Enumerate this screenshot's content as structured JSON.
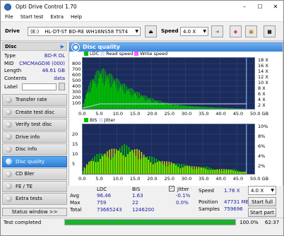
{
  "app": {
    "title": "Opti Drive Control 1.70"
  },
  "menu": [
    "File",
    "Start test",
    "Extra",
    "Help"
  ],
  "drivebar": {
    "drive_label": "Drive",
    "drive_letter": "(E:)",
    "drive_name": "HL-DT-ST BD-RE  WH16NS58 TST4",
    "speed_label": "Speed",
    "speed_value": "4.0 X"
  },
  "disc": {
    "heading": "Disc",
    "fields": [
      {
        "key": "Type",
        "value": "BD-R DL"
      },
      {
        "key": "MID",
        "value": "CMCMAGDI6 (000)"
      },
      {
        "key": "Length",
        "value": "46.61 GB"
      },
      {
        "key": "Contents",
        "value": "data"
      }
    ],
    "label_key": "Label"
  },
  "nav": [
    {
      "label": "Transfer rate"
    },
    {
      "label": "Create test disc"
    },
    {
      "label": "Verify test disc"
    },
    {
      "label": "Drive info"
    },
    {
      "label": "Disc info"
    },
    {
      "label": "Disc quality"
    },
    {
      "label": "CD Bler"
    },
    {
      "label": "FE / TE"
    },
    {
      "label": "Extra tests"
    }
  ],
  "status_window": "Status window >>",
  "panel": {
    "title": "Disc quality"
  },
  "chart_data": [
    {
      "type": "area",
      "legend": [
        "LDC",
        "Read speed",
        "Write speed"
      ],
      "x_ticks": [
        "0.0",
        "5.0",
        "10.0",
        "15.0",
        "20.0",
        "25.0",
        "30.0",
        "35.0",
        "40.0",
        "45.0",
        "50.0 GB"
      ],
      "y_left_ticks": [
        "800",
        "700",
        "600",
        "500",
        "400",
        "300",
        "200",
        "100"
      ],
      "y_right_ticks": [
        "18 X",
        "16 X",
        "14 X",
        "12 X",
        "10 X",
        "8 X",
        "6 X",
        "4 X",
        "2 X"
      ],
      "xlim": [
        0,
        50
      ],
      "ylim": [
        0,
        800
      ],
      "ldc_series": {
        "x": [
          0,
          1,
          2,
          3,
          4,
          5,
          6,
          7,
          8,
          9,
          10,
          11,
          12,
          13,
          14,
          15,
          16,
          17,
          18,
          19,
          20,
          21,
          22,
          23,
          24,
          25,
          26,
          27,
          28,
          29,
          30,
          31,
          32,
          33,
          34,
          35,
          36,
          37,
          38,
          39,
          40,
          41,
          42,
          43,
          44,
          45,
          46,
          47,
          47.7
        ],
        "y": [
          40,
          280,
          420,
          520,
          600,
          650,
          640,
          600,
          560,
          520,
          480,
          440,
          400,
          360,
          330,
          300,
          270,
          240,
          215,
          190,
          170,
          150,
          135,
          120,
          105,
          95,
          85,
          75,
          70,
          60,
          55,
          50,
          45,
          40,
          38,
          35,
          30,
          28,
          25,
          22,
          20,
          18,
          16,
          14,
          12,
          10,
          8,
          6,
          4
        ]
      },
      "speed_series": {
        "x": [
          0,
          5,
          10,
          15,
          20,
          25,
          30,
          35,
          40,
          45,
          47.7
        ],
        "y": [
          0.2,
          1.76,
          1.76,
          1.76,
          1.76,
          1.76,
          1.76,
          1.76,
          1.76,
          1.76,
          1.76
        ]
      }
    },
    {
      "type": "area",
      "legend": [
        "BIS",
        "Jitter"
      ],
      "x_ticks": [
        "0.0",
        "5.0",
        "10.0",
        "15.0",
        "20.0",
        "25.0",
        "30.0",
        "35.0",
        "40.0",
        "45.0",
        "50.0 GB"
      ],
      "y_left_ticks": [
        "20",
        "15",
        "10",
        "5"
      ],
      "y_right_ticks": [
        "10%",
        "8%",
        "6%",
        "4%",
        "2%"
      ],
      "xlim": [
        0,
        50
      ],
      "ylim": [
        0,
        20
      ],
      "bis_series": {
        "x": [
          0,
          2,
          4,
          6,
          8,
          10,
          12,
          14,
          16,
          18,
          20,
          22,
          24,
          26,
          28,
          30,
          32,
          34,
          36,
          38,
          40,
          42,
          44,
          46,
          47.7
        ],
        "y": [
          2,
          6,
          8,
          9,
          10,
          11,
          12,
          11,
          10,
          8,
          7,
          6,
          5,
          5,
          4,
          4,
          3,
          3,
          3,
          2,
          2,
          2,
          2,
          1,
          1
        ]
      }
    }
  ],
  "stats": {
    "col_ldc": "LDC",
    "col_bis": "BIS",
    "jitter_label": "Jitter",
    "rows": [
      {
        "name": "Avg",
        "ldc": "96.46",
        "bis": "1.63",
        "jitter": "-0.1%"
      },
      {
        "name": "Max",
        "ldc": "759",
        "bis": "22",
        "jitter": "0.0%"
      },
      {
        "name": "Total",
        "ldc": "73665243",
        "bis": "1246200",
        "jitter": ""
      }
    ],
    "speed_label": "Speed",
    "speed_value": "1.76 X",
    "speed_select": "4.0 X",
    "position_label": "Position",
    "position_value": "47731 MB",
    "samples_label": "Samples",
    "samples_value": "759696",
    "start_full": "Start full",
    "start_part": "Start part"
  },
  "statusbar": {
    "text": "Test completed",
    "progress_pct": 100,
    "progress_text": "100.0%",
    "time": "62:37"
  },
  "colors": {
    "accent": "#3d86da",
    "ldc": "#00c000",
    "chart_bg": "#1b2b5c",
    "progress": "#20b030"
  }
}
